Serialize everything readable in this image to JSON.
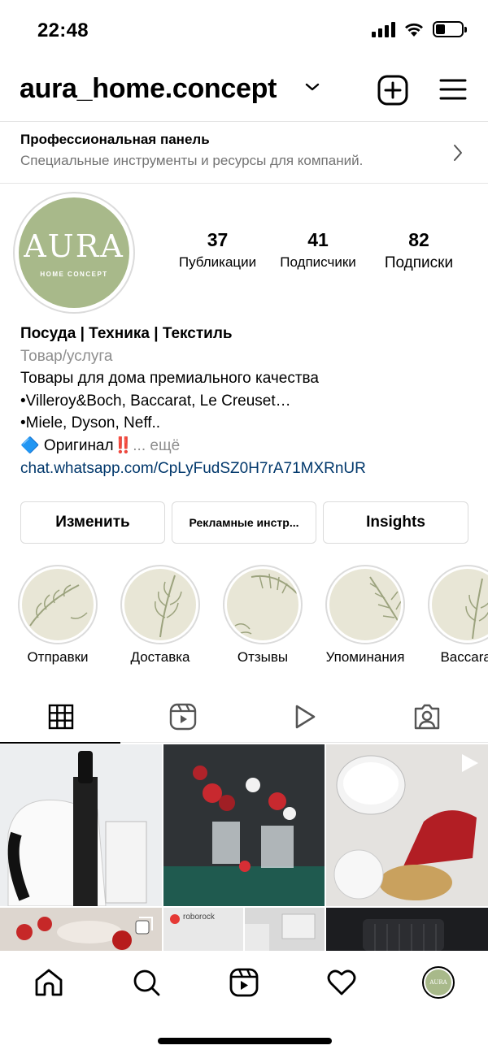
{
  "status_bar": {
    "time": "22:48",
    "battery_level": 0.35
  },
  "header": {
    "username": "aura_home.concept",
    "icons": [
      "chevron-down-icon",
      "add-post-icon",
      "menu-icon"
    ]
  },
  "pro_dashboard": {
    "title": "Профессиональная панель",
    "subtitle": "Специальные инструменты и ресурсы для компаний."
  },
  "profile": {
    "avatar": {
      "logo_text": "AURA",
      "tagline": "HOME CONCEPT"
    },
    "stats": [
      {
        "value": "37",
        "label": "Публикации"
      },
      {
        "value": "41",
        "label": "Подписчики"
      },
      {
        "value": "82",
        "label": "Подписки"
      }
    ],
    "bio": {
      "name": "Посуда | Техника | Текстиль",
      "category": "Товар/услуга",
      "line1": "Товары для дома премиального качества",
      "line2": "•Villeroy&Boch, Baccarat, Le Creuset…",
      "line3": "•Miele, Dyson, Neff..",
      "line4_prefix": "🔷 Оригинал",
      "line4_emoji": "‼️",
      "more": "... ещё",
      "link": "chat.whatsapp.com/CpLyFudSZ0H7rA71MXRnUR"
    }
  },
  "buttons": {
    "edit": "Изменить",
    "ad_tools": "Рекламные инстр...",
    "insights": "Insights"
  },
  "highlights": [
    {
      "label": "Отправки"
    },
    {
      "label": "Доставка"
    },
    {
      "label": "Отзывы"
    },
    {
      "label": "Упоминания"
    },
    {
      "label": "Baccarat"
    }
  ],
  "tabs": [
    "grid-icon",
    "reels-icon",
    "video-icon",
    "tagged-icon"
  ],
  "posts": [
    {
      "subject": "kitchen appliance",
      "badge": ""
    },
    {
      "subject": "vases with flowers",
      "badge": ""
    },
    {
      "subject": "stand mixer",
      "badge": "video-icon"
    },
    {
      "subject": "food plate",
      "badge": "carousel-icon"
    },
    {
      "subject": "roborock",
      "badge": "",
      "text": "roborock"
    },
    {
      "subject": "interior",
      "badge": ""
    },
    {
      "subject": "waffle maker",
      "badge": ""
    }
  ],
  "bottom_nav": [
    "home-icon",
    "search-icon",
    "reels-icon",
    "heart-icon",
    "profile-avatar"
  ],
  "colors": {
    "avatar_bg": "#a8b98a",
    "link": "#00376b",
    "muted": "#737373",
    "highlight_bg": "#e8e6d6"
  }
}
